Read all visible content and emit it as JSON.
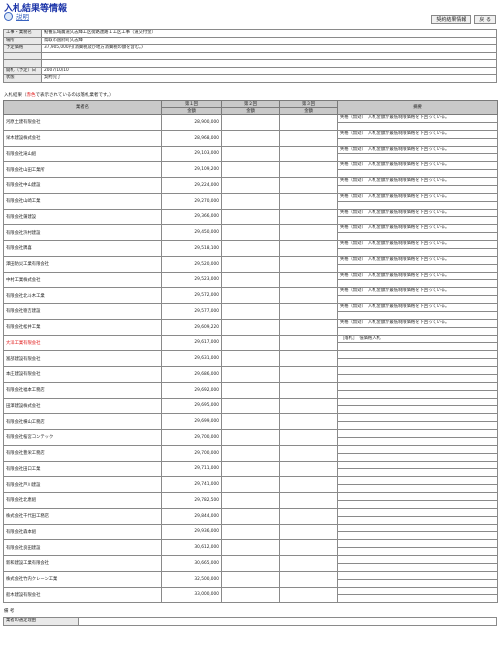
{
  "page": {
    "title": "入札結果等情報",
    "help": "説明"
  },
  "buttons": {
    "contract": "契約結果情報",
    "back": "戻 る"
  },
  "info": [
    {
      "label": "工事・業務名",
      "value": "鮎養広域農道久志輝工区街路連路１工区工事（道交付金）"
    },
    {
      "label": "場所",
      "value": "鳥取市国府町久志輝"
    },
    {
      "label": "予定価格",
      "value": "37,905,000円(消費税及び地方消費税の額を含む。)"
    },
    {
      "label": "",
      "value": ""
    },
    {
      "label": "",
      "value": ""
    },
    {
      "label": "開札（予定）日",
      "value": "2007/10/10"
    },
    {
      "label": "状態",
      "value": "契約完了"
    }
  ],
  "note": {
    "prefix": "入札結果（",
    "red": "赤色",
    "suffix": "で表示されているのは落札業者です。）"
  },
  "headers": {
    "name": "業者名",
    "round1": "第１回",
    "round2": "第２回",
    "round3": "第３回",
    "amount": "金額",
    "remarks": "摘要"
  },
  "bidders": [
    {
      "name": "河原土建有限会社",
      "amount": "28,900,000",
      "remark": "失格（無効）　入札金額が最低制限価格を下回っている。",
      "winner": false
    },
    {
      "name": "栄木建設株式会社",
      "amount": "28,968,000",
      "remark": "失格（無効）　入札金額が最低制限価格を下回っている。",
      "winner": false
    },
    {
      "name": "有限会社滝山組",
      "amount": "29,103,000",
      "remark": "失格（無効）　入札金額が最低制限価格を下回っている。",
      "winner": false
    },
    {
      "name": "有限会社山田工業所",
      "amount": "29,109,200",
      "remark": "失格（無効）　入札金額が最低制限価格を下回っている。",
      "winner": false
    },
    {
      "name": "有限会社中山建設",
      "amount": "29,224,000",
      "remark": "失格（無効）　入札金額が最低制限価格を下回っている。",
      "winner": false
    },
    {
      "name": "有限会社山崎工業",
      "amount": "29,270,000",
      "remark": "失格（無効）　入札金額が最低制限価格を下回っている。",
      "winner": false
    },
    {
      "name": "有限会社蒲建設",
      "amount": "29,366,000",
      "remark": "失格（無効）　入札金額が最低制限価格を下回っている。",
      "winner": false
    },
    {
      "name": "有限会社浜村建設",
      "amount": "29,450,000",
      "remark": "失格（無効）　入札金額が最低制限価格を下回っている。",
      "winner": false
    },
    {
      "name": "有限会社隅喜",
      "amount": "29,518,100",
      "remark": "失格（無効）　入札金額が最低制限価格を下回っている。",
      "winner": false
    },
    {
      "name": "澤田防災工業有限会社",
      "amount": "29,520,000",
      "remark": "失格（無効）　入札金額が最低制限価格を下回っている。",
      "winner": false
    },
    {
      "name": "中村工業株式会社",
      "amount": "29,523,000",
      "remark": "失格（無効）　入札金額が最低制限価格を下回っている。",
      "winner": false
    },
    {
      "name": "有限会社北斗木工業",
      "amount": "29,572,000",
      "remark": "失格（無効）　入札金額が最低制限価格を下回っている。",
      "winner": false
    },
    {
      "name": "有限会社徳吉建設",
      "amount": "29,577,000",
      "remark": "失格（無効）　入札金額が最低制限価格を下回っている。",
      "winner": false
    },
    {
      "name": "有限会社松井工業",
      "amount": "29,609,220",
      "remark": "失格（無効）　入札金額が最低制限価格を下回っている。",
      "winner": false
    },
    {
      "name": "大洋工業有限会社",
      "amount": "29,617,000",
      "remark": "［落札］　低価格入札",
      "winner": true
    },
    {
      "name": "富部建設有限会社",
      "amount": "29,631,000",
      "remark": "",
      "winner": false
    },
    {
      "name": "本庄建設有限会社",
      "amount": "29,686,000",
      "remark": "",
      "winner": false
    },
    {
      "name": "有限会社福本工務店",
      "amount": "29,692,000",
      "remark": "",
      "winner": false
    },
    {
      "name": "田澤建設株式会社",
      "amount": "29,695,000",
      "remark": "",
      "winner": false
    },
    {
      "name": "有限会社横山工務店",
      "amount": "29,699,000",
      "remark": "",
      "winner": false
    },
    {
      "name": "有限会社桜宮コンテック",
      "amount": "29,700,000",
      "remark": "",
      "winner": false
    },
    {
      "name": "有限会社豊栄工務店",
      "amount": "29,700,000",
      "remark": "",
      "winner": false
    },
    {
      "name": "有限会社田口工業",
      "amount": "29,711,000",
      "remark": "",
      "winner": false
    },
    {
      "name": "有限会社芦川建設",
      "amount": "29,741,000",
      "remark": "",
      "winner": false
    },
    {
      "name": "有限会社北恵組",
      "amount": "29,782,500",
      "remark": "",
      "winner": false
    },
    {
      "name": "株式会社千代田工務店",
      "amount": "29,844,000",
      "remark": "",
      "winner": false
    },
    {
      "name": "有限会社森本組",
      "amount": "29,936,000",
      "remark": "",
      "winner": false
    },
    {
      "name": "有限会社良田建設",
      "amount": "30,612,000",
      "remark": "",
      "winner": false
    },
    {
      "name": "新和建設工業有限会社",
      "amount": "30,665,000",
      "remark": "",
      "winner": false
    },
    {
      "name": "株式会社竹内クレーン工業",
      "amount": "32,500,000",
      "remark": "",
      "winner": false
    },
    {
      "name": "船木建設有限会社",
      "amount": "33,000,000",
      "remark": "",
      "winner": false
    }
  ],
  "bikou": {
    "title": "備 考",
    "label": "業者の選定理由",
    "value": ""
  }
}
